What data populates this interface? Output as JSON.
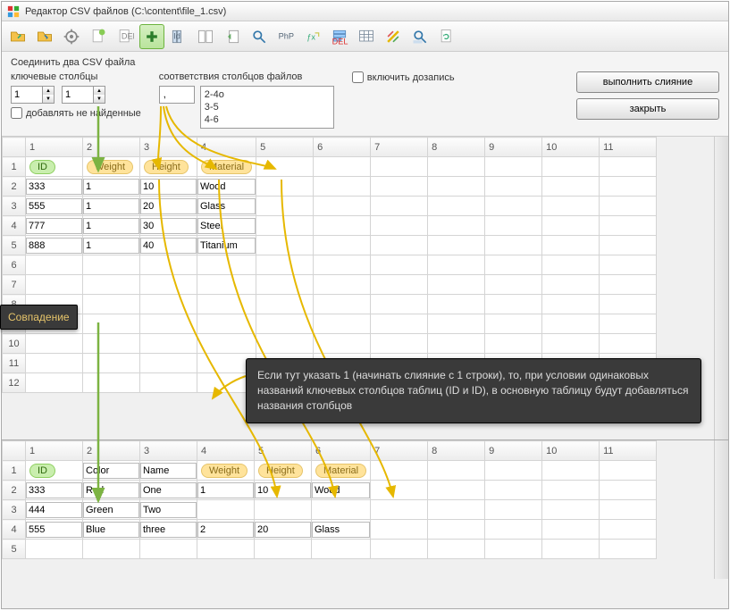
{
  "window": {
    "title": "Редактор CSV файлов (C:\\content\\file_1.csv)"
  },
  "toolbar_icons": [
    "open",
    "save",
    "settings",
    "new",
    "delete",
    "add",
    "columns",
    "book",
    "slide-left",
    "find",
    "php",
    "fx",
    "filter",
    "table",
    "color",
    "zoom",
    "refresh"
  ],
  "panel": {
    "title": "Соединить два CSV файла",
    "key_cols_label": "ключевые столбцы",
    "map_label": "соответствия столбцов  файлов",
    "append_label": "включить дозапись",
    "add_missing_label": "добавлять не найденные",
    "spin1": "1",
    "spin2": "1",
    "sep": ",",
    "map_rows": [
      "2-4о",
      "3-5",
      "4-6"
    ],
    "btn_merge": "выполнить слияние",
    "btn_close": "закрыть"
  },
  "grid1": {
    "col_nums": [
      "",
      "1",
      "2",
      "3",
      "4",
      "5",
      "6",
      "7",
      "8",
      "9",
      "10",
      "11"
    ],
    "rows": [
      {
        "n": "1",
        "cells": [
          "ID",
          "Weight",
          "Height",
          "Material",
          "",
          "",
          "",
          "",
          "",
          "",
          ""
        ],
        "pill": [
          0,
          1,
          2,
          3
        ],
        "greenPill": 0,
        "input": true
      },
      {
        "n": "2",
        "cells": [
          "333",
          "1",
          "10",
          "Wood",
          "",
          "",
          "",
          "",
          "",
          "",
          ""
        ],
        "input": true
      },
      {
        "n": "3",
        "cells": [
          "555",
          "1",
          "20",
          "Glass",
          "",
          "",
          "",
          "",
          "",
          "",
          ""
        ],
        "input": true
      },
      {
        "n": "4",
        "cells": [
          "777",
          "1",
          "30",
          "Steel",
          "",
          "",
          "",
          "",
          "",
          "",
          ""
        ],
        "input": true
      },
      {
        "n": "5",
        "cells": [
          "888",
          "1",
          "40",
          "Titanium",
          "",
          "",
          "",
          "",
          "",
          "",
          ""
        ],
        "input": true
      },
      {
        "n": "6",
        "cells": [
          "",
          "",
          "",
          "",
          "",
          "",
          "",
          "",
          "",
          "",
          ""
        ]
      },
      {
        "n": "7",
        "cells": [
          "",
          "",
          "",
          "",
          "",
          "",
          "",
          "",
          "",
          "",
          ""
        ]
      },
      {
        "n": "8",
        "cells": [
          "",
          "",
          "",
          "",
          "",
          "",
          "",
          "",
          "",
          "",
          ""
        ]
      },
      {
        "n": "9",
        "cells": [
          "",
          "",
          "",
          "",
          "",
          "",
          "",
          "",
          "",
          "",
          ""
        ]
      },
      {
        "n": "10",
        "cells": [
          "",
          "",
          "",
          "",
          "",
          "",
          "",
          "",
          "",
          "",
          ""
        ]
      },
      {
        "n": "11",
        "cells": [
          "",
          "",
          "",
          "",
          "",
          "",
          "",
          "",
          "",
          "",
          ""
        ]
      },
      {
        "n": "12",
        "cells": [
          "",
          "",
          "",
          "",
          "",
          "",
          "",
          "",
          "",
          "",
          ""
        ]
      }
    ]
  },
  "grid2": {
    "col_nums": [
      "",
      "1",
      "2",
      "3",
      "4",
      "5",
      "6",
      "7",
      "8",
      "9",
      "10",
      "11"
    ],
    "rows": [
      {
        "n": "1",
        "cells": [
          "ID",
          "Color",
          "Name",
          "Weight",
          "Height",
          "Material",
          "",
          "",
          "",
          "",
          ""
        ],
        "pill": [
          3,
          4,
          5
        ],
        "greenPill": 0,
        "input": true
      },
      {
        "n": "2",
        "cells": [
          "333",
          "Red",
          "One",
          "1",
          "10",
          "Wood",
          "",
          "",
          "",
          "",
          ""
        ],
        "input": true
      },
      {
        "n": "3",
        "cells": [
          "444",
          "Green",
          "Two",
          "",
          "",
          "",
          "",
          "",
          "",
          "",
          ""
        ],
        "input": true
      },
      {
        "n": "4",
        "cells": [
          "555",
          "Blue",
          "three",
          "2",
          "20",
          "Glass",
          "",
          "",
          "",
          "",
          ""
        ],
        "input": true
      },
      {
        "n": "5",
        "cells": [
          "",
          "",
          "",
          "",
          "",
          "",
          "",
          "",
          "",
          "",
          ""
        ]
      }
    ]
  },
  "overlay": {
    "match": "Совпадение",
    "hint": "Если тут указать 1 (начинать слияние с 1 строки), то, при условии одинаковых названий ключевых столбцов таблиц (ID и ID), в основную таблицу будут добавляться названия столбцов"
  }
}
